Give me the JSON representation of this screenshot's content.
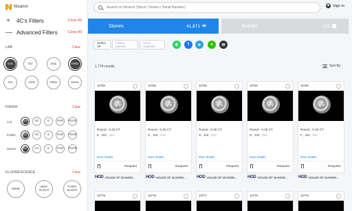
{
  "logo": {
    "text": "Nicanor"
  },
  "sidebar": {
    "fourc_filters": {
      "symbol": "+",
      "label": "4C's Filters",
      "clear": "Clear All"
    },
    "advanced_filters": {
      "symbol": "—",
      "label": "Advanced Filters",
      "clear": "Clear All"
    },
    "lab": {
      "label": "LAB",
      "clear": "Clear",
      "options": [
        "GIA",
        "IGI",
        "SGL",
        "HRD",
        "IDI",
        "AGS",
        "Other",
        "None"
      ],
      "selected": [
        "GIA",
        "HRD"
      ]
    },
    "finish": {
      "label": "FINISH",
      "clear": "Clear",
      "rows": [
        {
          "label": "Cut",
          "options": [
            "EX",
            "VG",
            "G",
            "FAIR",
            "POOR"
          ]
        },
        {
          "label": "Polish",
          "options": [
            "EX",
            "VG",
            "G",
            "FAIR",
            "POOR"
          ]
        },
        {
          "label": "Symm",
          "options": [
            "EX",
            "VG",
            "G",
            "FAIR",
            "POOR"
          ]
        }
      ],
      "selected": [
        "EX"
      ]
    },
    "fluorescence": {
      "label": "FLUORESCENCE",
      "clear": "Clear",
      "options": [
        "NONE",
        "VERY SLIGHT",
        "FAINT/ SLIGHT"
      ]
    }
  },
  "search": {
    "placeholder": "Search on Nicanor (Stock / Stones / Serial Number)"
  },
  "signin": {
    "label": "Sign in"
  },
  "tabs": [
    {
      "label": "Stones",
      "count": "41,871"
    },
    {
      "label": "Brands",
      "count": "125"
    }
  ],
  "actions": {
    "select_all": "Select All",
    "add_to_parcels": "Add to parcels",
    "send_requests": "Send requests"
  },
  "share_icons": [
    "whatsapp-icon",
    "facebook-icon",
    "telegram-icon",
    "wechat-icon",
    "email-icon"
  ],
  "colors": {
    "primary": "#1f86e8",
    "clear": "#e0443e",
    "brands_tab": "#d9dadc",
    "whatsapp": "#25d366",
    "facebook": "#1877f2",
    "telegram": "#2aa3dc",
    "wechat": "#2dc100",
    "email": "#333333"
  },
  "results": {
    "label": "1,774 results",
    "sort_label": "Sort By"
  },
  "cards": [
    {
      "id": "10786",
      "shape_carat": "Round , 0.33 CT",
      "color": "K",
      "clarity": "SI2",
      "lab": "GIA",
      "more": "More details",
      "request": "Request",
      "brand": "HOD",
      "brand_name": "HOUSE OF DIAMON..."
    },
    {
      "id": "10785",
      "shape_carat": "Round , 0.40 CT",
      "color": "G",
      "clarity": "SI2",
      "lab": "GIA",
      "more": "More details",
      "request": "Request",
      "brand": "HOD",
      "brand_name": "HOUSE OF DIAMON..."
    },
    {
      "id": "10783",
      "shape_carat": "Round , 0.40 CT",
      "color": "G",
      "clarity": "SI2",
      "lab": "GIA",
      "more": "More details",
      "request": "Request",
      "brand": "HOD",
      "brand_name": "HOUSE OF DIAMON..."
    },
    {
      "id": "10782",
      "shape_carat": "Round , 0.40 CT",
      "color": "G",
      "clarity": "SI2",
      "lab": "GIA",
      "more": "More details",
      "request": "Request",
      "brand": "HOD",
      "brand_name": "HOUSE OF DIAMON..."
    },
    {
      "id": "10780",
      "shape_carat": "Round , 0.40 CT",
      "color": "F",
      "clarity": "SI2",
      "lab": "GIA",
      "more": "More details",
      "request": "Request",
      "brand": "HOD",
      "brand_name": "HOUSE OF DIAMON..."
    }
  ],
  "cards_row2": [
    "10779",
    "10778",
    "10777",
    "10776",
    "10775"
  ]
}
